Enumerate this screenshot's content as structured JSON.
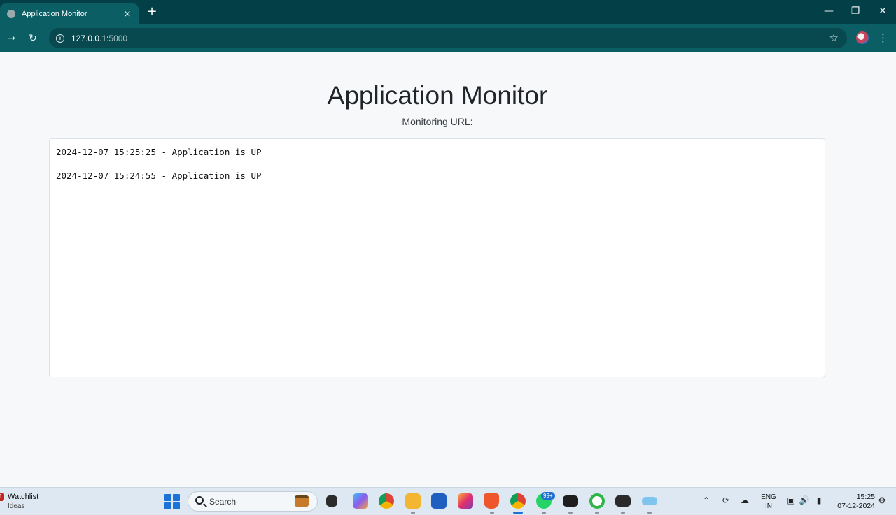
{
  "browser": {
    "tab_title": "Application Monitor",
    "new_tab": "+",
    "close_tab": "×",
    "url_host": "127.0.0.1:",
    "url_port": "5000"
  },
  "page": {
    "title": "Application Monitor",
    "subtitle": "Monitoring URL:",
    "logs": [
      "2024-12-07 15:25:25 - Application is UP",
      "2024-12-07 15:24:55 - Application is UP"
    ]
  },
  "taskbar": {
    "widget_title": "Watchlist",
    "widget_subtitle": "Ideas",
    "widget_badge": "1",
    "search_placeholder": "Search",
    "whatsapp_badge": "99+",
    "lang_line1": "ENG",
    "lang_line2": "IN",
    "time": "15:25",
    "date": "07-12-2024"
  },
  "colors": {
    "titlebar": "#023f47",
    "toolbar": "#0b5e63",
    "page_bg": "#f7f8fa",
    "accent": "#1b72d8"
  }
}
